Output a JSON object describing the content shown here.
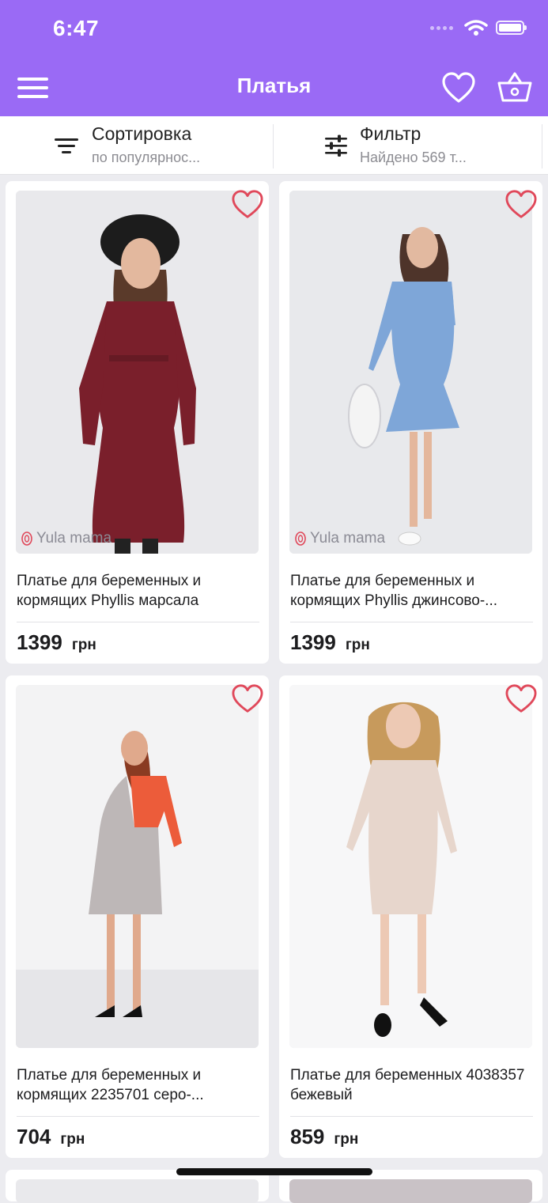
{
  "status": {
    "time": "6:47"
  },
  "header": {
    "title": "Платья"
  },
  "toolbar": {
    "sort": {
      "title": "Сортировка",
      "subtitle": "по популярнос..."
    },
    "filter": {
      "title": "Фильтр",
      "subtitle": "Найдено 569 т..."
    }
  },
  "products": [
    {
      "name": "Платье для беременных и кормящих Phyllis марсала",
      "price": "1399",
      "currency": "грн",
      "brand": "Yula mama",
      "dress_color": "#7a1f2b"
    },
    {
      "name": "Платье для беременных и кормящих Phyllis джинсово-...",
      "price": "1399",
      "currency": "грн",
      "brand": "Yula mama",
      "dress_color": "#7ea6d8"
    },
    {
      "name": "Платье для беременных и кормящих 2235701 серо-...",
      "price": "704",
      "currency": "грн",
      "dress_color": "#b9b3b3"
    },
    {
      "name": "Платье для беременных 4038357 бежевый",
      "price": "859",
      "currency": "грн",
      "dress_color": "#e7d6cc"
    }
  ],
  "colors": {
    "accent": "#9a6af5",
    "favorite": "#e0485a"
  }
}
